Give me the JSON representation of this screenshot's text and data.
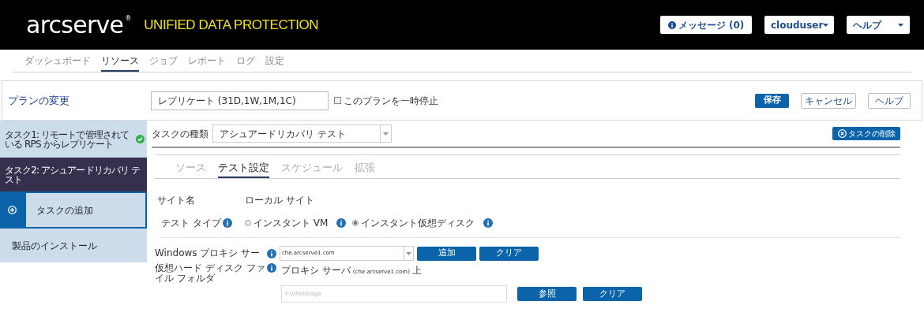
{
  "header": {
    "logo": "arcserve",
    "registered": "®",
    "product": "UNIFIED DATA PROTECTION",
    "messages_button": "メッセージ (0)",
    "user_menu": "clouduser",
    "help_menu": "ヘルプ"
  },
  "nav_tabs": [
    {
      "label": "ダッシュボード",
      "selected": false
    },
    {
      "label": "リソース",
      "selected": true
    },
    {
      "label": "ジョブ",
      "selected": false
    },
    {
      "label": "レポート",
      "selected": false
    },
    {
      "label": "ログ",
      "selected": false
    },
    {
      "label": "設定",
      "selected": false
    }
  ],
  "plan": {
    "title": "プランの変更",
    "name": "レプリケート (31D,1W,1M,1C)",
    "pause": {
      "label": "このプランを一時停止",
      "checked": false
    },
    "buttons": [
      "保存",
      "キャンセル",
      "ヘルプ"
    ]
  },
  "sidebar": [
    {
      "kind": "task",
      "label": "タスク1: リモートで管理されている RPS からレプリケート",
      "selected": false,
      "completed": true
    },
    {
      "kind": "task",
      "label": "タスク2: アシュアードリカバリ テスト",
      "selected": true,
      "completed": false
    },
    {
      "kind": "add",
      "label": "タスクの追加"
    },
    {
      "kind": "link",
      "label": "製品のインストール"
    }
  ],
  "task_type": {
    "label": "タスクの種類",
    "value": "アシュアードリカバリ テスト",
    "delete_button": "タスクの削除"
  },
  "sub_tabs": [
    {
      "label": "ソース",
      "selected": false
    },
    {
      "label": "テスト設定",
      "selected": true
    },
    {
      "label": "スケジュール",
      "selected": false
    },
    {
      "label": "拡張",
      "selected": false
    }
  ],
  "site": {
    "label": "サイト名",
    "value": "ローカル サイト"
  },
  "test_type": {
    "label": "テスト タイプ",
    "options": [
      {
        "label": "インスタント VM",
        "selected": false
      },
      {
        "label": "インスタント仮想ディスク",
        "selected": true
      }
    ]
  },
  "proxy": {
    "label": "Windows プロキシ サー",
    "value": "che.arcserve1.com",
    "buttons": [
      "追加",
      "クリア"
    ]
  },
  "folder": {
    "label": "仮想ハード ディスク ファイル フォルダ",
    "prefix": "プロキシ サーバ",
    "server": "(che.arcserve1.com)",
    "suffix": "上",
    "placeholder": "F:\\VMstorage",
    "buttons": [
      "参照",
      "クリア"
    ]
  }
}
